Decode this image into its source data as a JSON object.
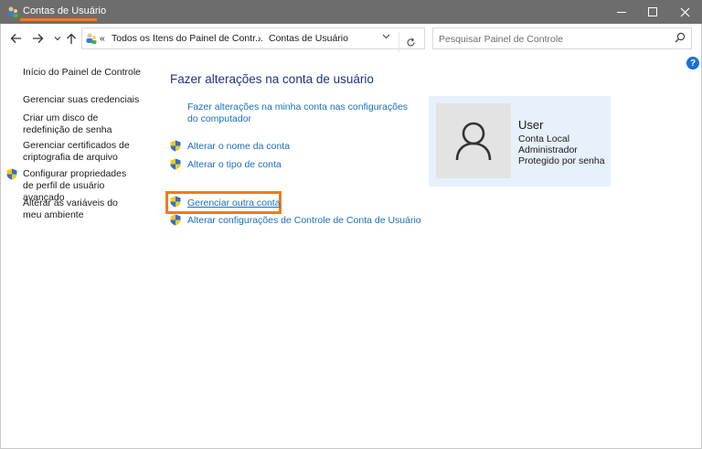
{
  "window": {
    "title": "Contas de Usuário",
    "accent_color": "#f07a1f",
    "minimize_icon": "minimize-icon",
    "maximize_icon": "maximize-icon",
    "close_icon": "close-icon"
  },
  "nav": {
    "back_icon": "arrow-left-icon",
    "forward_icon": "arrow-right-icon",
    "recent_icon": "chevron-down-icon",
    "up_icon": "arrow-up-icon",
    "breadcrumb": {
      "overflow": "«",
      "items": [
        "Todos os Itens do Painel de Contr...",
        "Contas de Usuário"
      ],
      "separator": "›"
    },
    "refresh_icon": "refresh-icon",
    "search_placeholder": "Pesquisar Painel de Controle"
  },
  "help": {
    "label": "?"
  },
  "sidebar": {
    "items": [
      {
        "label": "Início do Painel de Controle",
        "shield": false
      },
      {
        "label": "Gerenciar suas credenciais",
        "shield": false
      },
      {
        "label": "Criar um disco de redefinição de senha",
        "shield": false
      },
      {
        "label": "Gerenciar certificados de criptografia de arquivo",
        "shield": false
      },
      {
        "label": "Configurar propriedades de perfil de usuário avançado",
        "shield": true
      },
      {
        "label": "Alterar as variáveis do meu ambiente",
        "shield": false
      }
    ]
  },
  "main": {
    "title": "Fazer alterações na conta de usuário",
    "links": [
      {
        "label": "Fazer alterações na minha conta nas configurações do computador",
        "shield": false
      },
      {
        "label": "Alterar o nome da conta",
        "shield": true
      },
      {
        "label": "Alterar o tipo de conta",
        "shield": true
      },
      {
        "label": "Gerenciar outra conta",
        "shield": true,
        "highlighted": true
      },
      {
        "label": "Alterar configurações de Controle de Conta de Usuário",
        "shield": true
      }
    ]
  },
  "user_card": {
    "name": "User",
    "lines": [
      "Conta Local",
      "Administrador",
      "Protegido por senha"
    ],
    "background": "#e6f1fb"
  }
}
